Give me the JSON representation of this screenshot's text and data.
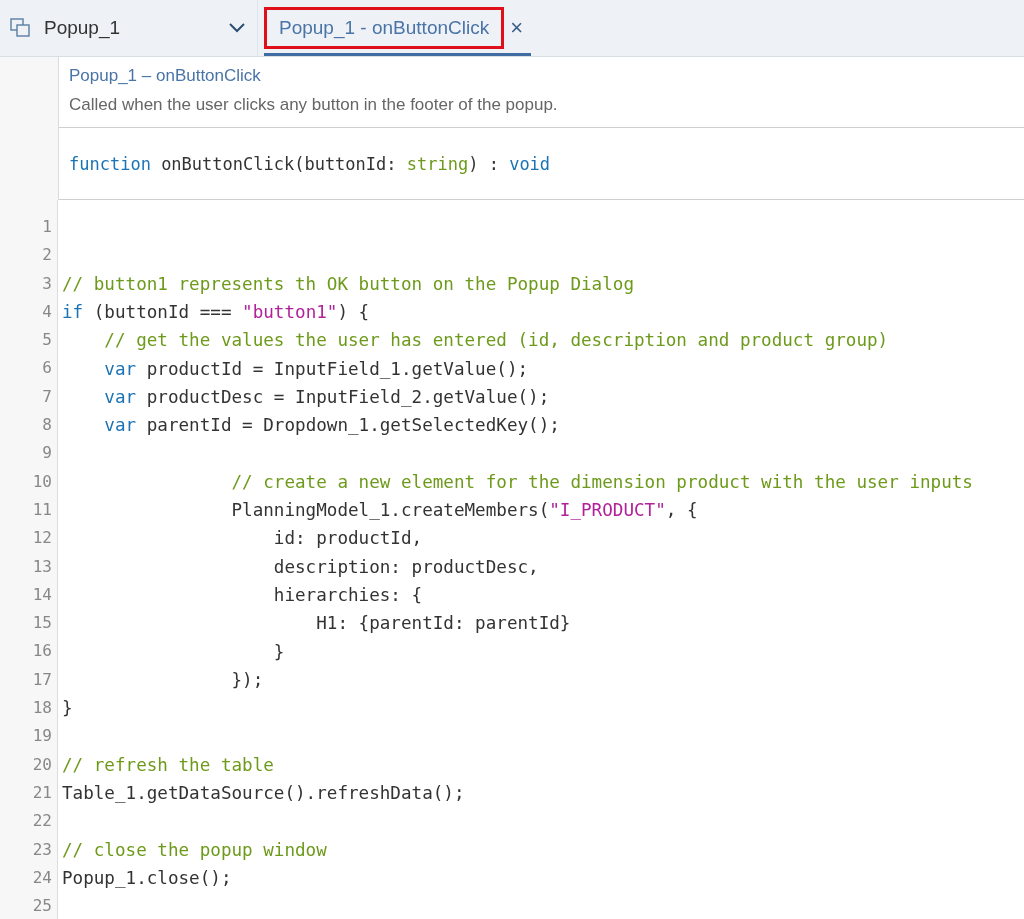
{
  "object_selector": {
    "label": "Popup_1",
    "expanded": false
  },
  "tabs": [
    {
      "label": "Popup_1 - onButtonClick",
      "selected": true,
      "highlighted": true,
      "close": "×"
    }
  ],
  "header": {
    "title": "Popup_1 – onButtonClick",
    "description": "Called when the user clicks any button in the footer of the popup.",
    "signature": [
      {
        "t": "function",
        "kind": "keyword"
      },
      {
        "t": " onButtonClick(buttonId: ",
        "kind": "plain"
      },
      {
        "t": "string",
        "kind": "type"
      },
      {
        "t": ") : ",
        "kind": "plain"
      },
      {
        "t": "void",
        "kind": "keyword"
      }
    ]
  },
  "code": [
    {
      "number": "1"
    },
    {
      "number": "2"
    },
    {
      "number": "3",
      "tokens": [
        {
          "t": "// button1 represents th OK button on the Popup Dialog",
          "kind": "comment"
        }
      ]
    },
    {
      "number": "4",
      "tokens": [
        {
          "t": "if",
          "kind": "keyword"
        },
        {
          "t": " (buttonId === ",
          "kind": "plain"
        },
        {
          "t": "\"button1\"",
          "kind": "string"
        },
        {
          "t": ") {",
          "kind": "plain"
        }
      ]
    },
    {
      "number": "5",
      "tokens": [
        {
          "t": "    // get the values the user has entered (id, description and product group)",
          "kind": "comment"
        }
      ]
    },
    {
      "number": "6",
      "tokens": [
        {
          "t": "    var",
          "kind": "keyword"
        },
        {
          "t": " productId = InputField_1.getValue();",
          "kind": "plain"
        }
      ]
    },
    {
      "number": "7",
      "tokens": [
        {
          "t": "    var",
          "kind": "keyword"
        },
        {
          "t": " productDesc = InputField_2.getValue();",
          "kind": "plain"
        }
      ]
    },
    {
      "number": "8",
      "tokens": [
        {
          "t": "    var",
          "kind": "keyword"
        },
        {
          "t": " parentId = Dropdown_1.getSelectedKey();",
          "kind": "plain"
        }
      ]
    },
    {
      "number": "9"
    },
    {
      "number": "10",
      "tokens": [
        {
          "t": "                // create a new element for the dimension product with the user inputs",
          "kind": "comment"
        }
      ]
    },
    {
      "number": "11",
      "tokens": [
        {
          "t": "                PlanningModel_1.createMembers(",
          "kind": "plain"
        },
        {
          "t": "\"I_PRODUCT\"",
          "kind": "string"
        },
        {
          "t": ", {",
          "kind": "plain"
        }
      ]
    },
    {
      "number": "12",
      "tokens": [
        {
          "t": "                    id: productId,",
          "kind": "plain"
        }
      ]
    },
    {
      "number": "13",
      "tokens": [
        {
          "t": "                    description: productDesc,",
          "kind": "plain"
        }
      ]
    },
    {
      "number": "14",
      "tokens": [
        {
          "t": "                    hierarchies: {",
          "kind": "plain"
        }
      ]
    },
    {
      "number": "15",
      "tokens": [
        {
          "t": "                        H1: {parentId: parentId}",
          "kind": "plain"
        }
      ]
    },
    {
      "number": "16",
      "tokens": [
        {
          "t": "                    }",
          "kind": "plain"
        }
      ]
    },
    {
      "number": "17",
      "tokens": [
        {
          "t": "                });",
          "kind": "plain"
        }
      ]
    },
    {
      "number": "18",
      "tokens": [
        {
          "t": "}",
          "kind": "plain"
        }
      ]
    },
    {
      "number": "19"
    },
    {
      "number": "20",
      "tokens": [
        {
          "t": "// refresh the table",
          "kind": "comment"
        }
      ]
    },
    {
      "number": "21",
      "tokens": [
        {
          "t": "Table_1.getDataSource().refreshData();",
          "kind": "plain"
        }
      ]
    },
    {
      "number": "22"
    },
    {
      "number": "23",
      "tokens": [
        {
          "t": "// close the popup window",
          "kind": "comment"
        }
      ]
    },
    {
      "number": "24",
      "tokens": [
        {
          "t": "Popup_1.close();",
          "kind": "plain"
        }
      ]
    },
    {
      "number": "25"
    }
  ]
}
